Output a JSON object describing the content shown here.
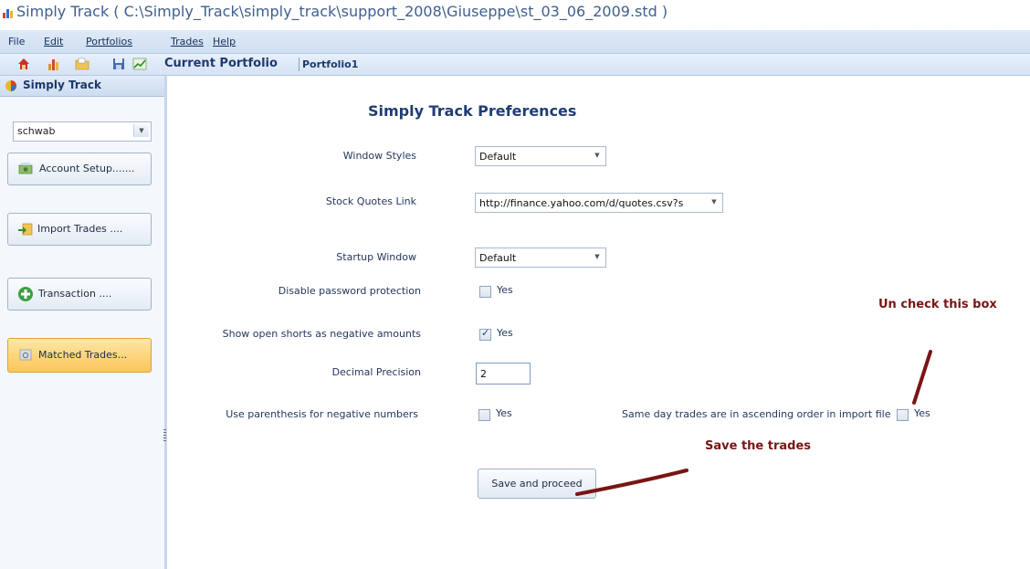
{
  "window": {
    "title": "Simply Track ( C:\\Simply_Track\\simply_track\\support_2008\\Giuseppe\\st_03_06_2009.std )"
  },
  "menu": {
    "file": "File",
    "edit": "Edit",
    "portfolios": "Portfolios",
    "trades": "Trades",
    "help": "Help"
  },
  "toolbar": {
    "current_portfolio_label": "Current Portfolio",
    "current_portfolio_value": "Portfolio1",
    "icons": [
      "home-icon",
      "chart-bars-icon",
      "open-folder-icon",
      "save-disk-icon",
      "line-chart-icon"
    ]
  },
  "sidebar": {
    "title": "Simply Track",
    "account_select": "schwab",
    "buttons": {
      "account_setup": "Account Setup.......",
      "import_trades": "Import Trades ....",
      "transaction": "Transaction      ....",
      "matched_trades": "Matched Trades..."
    }
  },
  "preferences": {
    "title": "Simply Track Preferences",
    "window_styles_label": "Window Styles",
    "window_styles_value": "Default",
    "stock_quotes_label": "Stock Quotes Link",
    "stock_quotes_value": "http://finance.yahoo.com/d/quotes.csv?s",
    "startup_window_label": "Startup Window",
    "startup_window_value": "Default",
    "disable_password_label": "Disable password protection",
    "disable_password_checked": false,
    "show_open_shorts_label": "Show open shorts as negative amounts",
    "show_open_shorts_checked": true,
    "decimal_precision_label": "Decimal Precision",
    "decimal_precision_value": "2",
    "use_parenthesis_label": "Use parenthesis for negative numbers",
    "use_parenthesis_checked": false,
    "same_day_label": "Same day trades are in ascending order in import file",
    "same_day_checked": false,
    "yes_label": "Yes",
    "save_button": "Save and proceed"
  },
  "annotations": {
    "uncheck": "Un check this box",
    "save": "Save the trades"
  },
  "colors": {
    "annotation": "#7a1414",
    "accent": "#1f3d74",
    "active_button": "#fbc65b"
  }
}
